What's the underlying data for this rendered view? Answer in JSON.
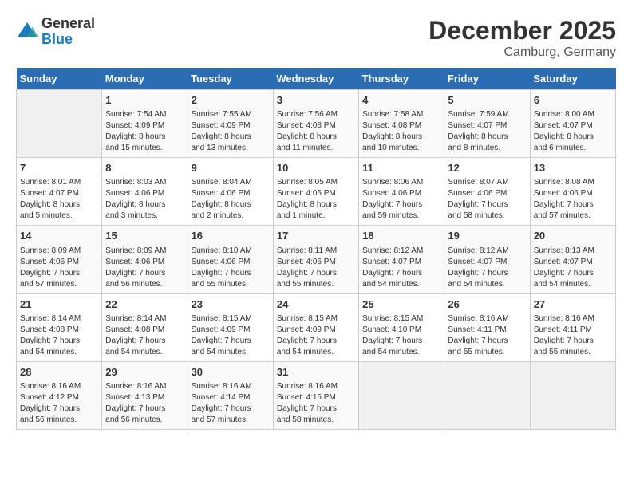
{
  "header": {
    "logo_line1": "General",
    "logo_line2": "Blue",
    "month_title": "December 2025",
    "location": "Camburg, Germany"
  },
  "calendar": {
    "days_of_week": [
      "Sunday",
      "Monday",
      "Tuesday",
      "Wednesday",
      "Thursday",
      "Friday",
      "Saturday"
    ],
    "weeks": [
      [
        {
          "day": "",
          "info": ""
        },
        {
          "day": "1",
          "info": "Sunrise: 7:54 AM\nSunset: 4:09 PM\nDaylight: 8 hours\nand 15 minutes."
        },
        {
          "day": "2",
          "info": "Sunrise: 7:55 AM\nSunset: 4:09 PM\nDaylight: 8 hours\nand 13 minutes."
        },
        {
          "day": "3",
          "info": "Sunrise: 7:56 AM\nSunset: 4:08 PM\nDaylight: 8 hours\nand 11 minutes."
        },
        {
          "day": "4",
          "info": "Sunrise: 7:58 AM\nSunset: 4:08 PM\nDaylight: 8 hours\nand 10 minutes."
        },
        {
          "day": "5",
          "info": "Sunrise: 7:59 AM\nSunset: 4:07 PM\nDaylight: 8 hours\nand 8 minutes."
        },
        {
          "day": "6",
          "info": "Sunrise: 8:00 AM\nSunset: 4:07 PM\nDaylight: 8 hours\nand 6 minutes."
        }
      ],
      [
        {
          "day": "7",
          "info": "Sunrise: 8:01 AM\nSunset: 4:07 PM\nDaylight: 8 hours\nand 5 minutes."
        },
        {
          "day": "8",
          "info": "Sunrise: 8:03 AM\nSunset: 4:06 PM\nDaylight: 8 hours\nand 3 minutes."
        },
        {
          "day": "9",
          "info": "Sunrise: 8:04 AM\nSunset: 4:06 PM\nDaylight: 8 hours\nand 2 minutes."
        },
        {
          "day": "10",
          "info": "Sunrise: 8:05 AM\nSunset: 4:06 PM\nDaylight: 8 hours\nand 1 minute."
        },
        {
          "day": "11",
          "info": "Sunrise: 8:06 AM\nSunset: 4:06 PM\nDaylight: 7 hours\nand 59 minutes."
        },
        {
          "day": "12",
          "info": "Sunrise: 8:07 AM\nSunset: 4:06 PM\nDaylight: 7 hours\nand 58 minutes."
        },
        {
          "day": "13",
          "info": "Sunrise: 8:08 AM\nSunset: 4:06 PM\nDaylight: 7 hours\nand 57 minutes."
        }
      ],
      [
        {
          "day": "14",
          "info": "Sunrise: 8:09 AM\nSunset: 4:06 PM\nDaylight: 7 hours\nand 57 minutes."
        },
        {
          "day": "15",
          "info": "Sunrise: 8:09 AM\nSunset: 4:06 PM\nDaylight: 7 hours\nand 56 minutes."
        },
        {
          "day": "16",
          "info": "Sunrise: 8:10 AM\nSunset: 4:06 PM\nDaylight: 7 hours\nand 55 minutes."
        },
        {
          "day": "17",
          "info": "Sunrise: 8:11 AM\nSunset: 4:06 PM\nDaylight: 7 hours\nand 55 minutes."
        },
        {
          "day": "18",
          "info": "Sunrise: 8:12 AM\nSunset: 4:07 PM\nDaylight: 7 hours\nand 54 minutes."
        },
        {
          "day": "19",
          "info": "Sunrise: 8:12 AM\nSunset: 4:07 PM\nDaylight: 7 hours\nand 54 minutes."
        },
        {
          "day": "20",
          "info": "Sunrise: 8:13 AM\nSunset: 4:07 PM\nDaylight: 7 hours\nand 54 minutes."
        }
      ],
      [
        {
          "day": "21",
          "info": "Sunrise: 8:14 AM\nSunset: 4:08 PM\nDaylight: 7 hours\nand 54 minutes."
        },
        {
          "day": "22",
          "info": "Sunrise: 8:14 AM\nSunset: 4:08 PM\nDaylight: 7 hours\nand 54 minutes."
        },
        {
          "day": "23",
          "info": "Sunrise: 8:15 AM\nSunset: 4:09 PM\nDaylight: 7 hours\nand 54 minutes."
        },
        {
          "day": "24",
          "info": "Sunrise: 8:15 AM\nSunset: 4:09 PM\nDaylight: 7 hours\nand 54 minutes."
        },
        {
          "day": "25",
          "info": "Sunrise: 8:15 AM\nSunset: 4:10 PM\nDaylight: 7 hours\nand 54 minutes."
        },
        {
          "day": "26",
          "info": "Sunrise: 8:16 AM\nSunset: 4:11 PM\nDaylight: 7 hours\nand 55 minutes."
        },
        {
          "day": "27",
          "info": "Sunrise: 8:16 AM\nSunset: 4:11 PM\nDaylight: 7 hours\nand 55 minutes."
        }
      ],
      [
        {
          "day": "28",
          "info": "Sunrise: 8:16 AM\nSunset: 4:12 PM\nDaylight: 7 hours\nand 56 minutes."
        },
        {
          "day": "29",
          "info": "Sunrise: 8:16 AM\nSunset: 4:13 PM\nDaylight: 7 hours\nand 56 minutes."
        },
        {
          "day": "30",
          "info": "Sunrise: 8:16 AM\nSunset: 4:14 PM\nDaylight: 7 hours\nand 57 minutes."
        },
        {
          "day": "31",
          "info": "Sunrise: 8:16 AM\nSunset: 4:15 PM\nDaylight: 7 hours\nand 58 minutes."
        },
        {
          "day": "",
          "info": ""
        },
        {
          "day": "",
          "info": ""
        },
        {
          "day": "",
          "info": ""
        }
      ]
    ]
  }
}
